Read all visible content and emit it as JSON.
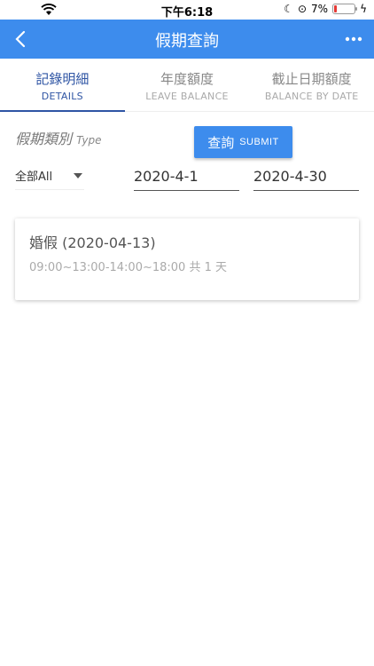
{
  "status": {
    "time": "下午6:18",
    "battery": "7%"
  },
  "appbar": {
    "title": "假期查詢"
  },
  "tabs": [
    {
      "zh": "記錄明細",
      "en": "DETAILS"
    },
    {
      "zh": "年度額度",
      "en": "LEAVE BALANCE"
    },
    {
      "zh": "截止日期額度",
      "en": "BALANCE BY DATE"
    }
  ],
  "filter": {
    "type_label_zh": "假期類別",
    "type_label_en": "Type",
    "type_value": "全部All",
    "start_date": "2020-4-1",
    "end_date": "2020-4-30",
    "submit_zh": "查詢",
    "submit_en": "SUBMIT"
  },
  "records": [
    {
      "name": "婚假 (2020-04-13)",
      "detail": "09:00~13:00-14:00~18:00 共 1 天"
    }
  ],
  "colors": {
    "primary": "#3d8ced",
    "tab_active": "#2f55a4"
  }
}
